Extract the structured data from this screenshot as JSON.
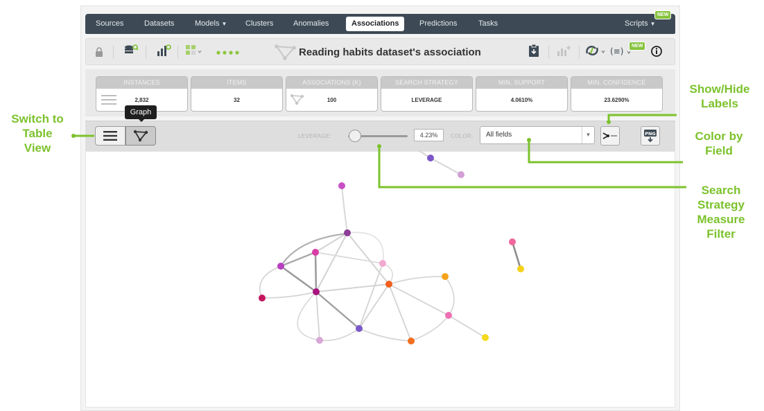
{
  "nav": {
    "items": [
      "Sources",
      "Datasets",
      "Models",
      "Clusters",
      "Anomalies",
      "Associations",
      "Predictions",
      "Tasks"
    ],
    "active": "Associations",
    "scripts": "Scripts",
    "new_badge": "NEW"
  },
  "toolbar": {
    "title": "Reading habits dataset's association",
    "new_badge": "NEW"
  },
  "stats": [
    {
      "label": "INSTANCES",
      "value": "2,832"
    },
    {
      "label": "ITEMS",
      "value": "32"
    },
    {
      "label": "ASSOCIATIONS (K)",
      "value": "100"
    },
    {
      "label": "SEARCH STRATEGY",
      "value": "LEVERAGE"
    },
    {
      "label": "MIN. SUPPORT",
      "value": "4.0610%"
    },
    {
      "label": "MIN. CONFIDENCE",
      "value": "23.6290%"
    }
  ],
  "graph_toolbar": {
    "tooltip": "Graph",
    "leverage_label": "LEVERAGE:",
    "leverage_value": "4.23%",
    "leverage_level": 0.05,
    "color_label": "COLOR:",
    "color_selected": "All fields",
    "png_label": "PNG"
  },
  "annotations": {
    "switch_view": [
      "Switch to",
      "Table",
      "View"
    ],
    "show_hide": [
      "Show/Hide",
      "Labels"
    ],
    "color_field": [
      "Color by",
      "Field"
    ],
    "search_filter": [
      "Search",
      "Strategy",
      "Measure",
      "Filter"
    ]
  },
  "colors": {
    "accent_green": "#7cc22c",
    "nav_bg": "#3d4a55",
    "badge_green": "#86c33d"
  }
}
